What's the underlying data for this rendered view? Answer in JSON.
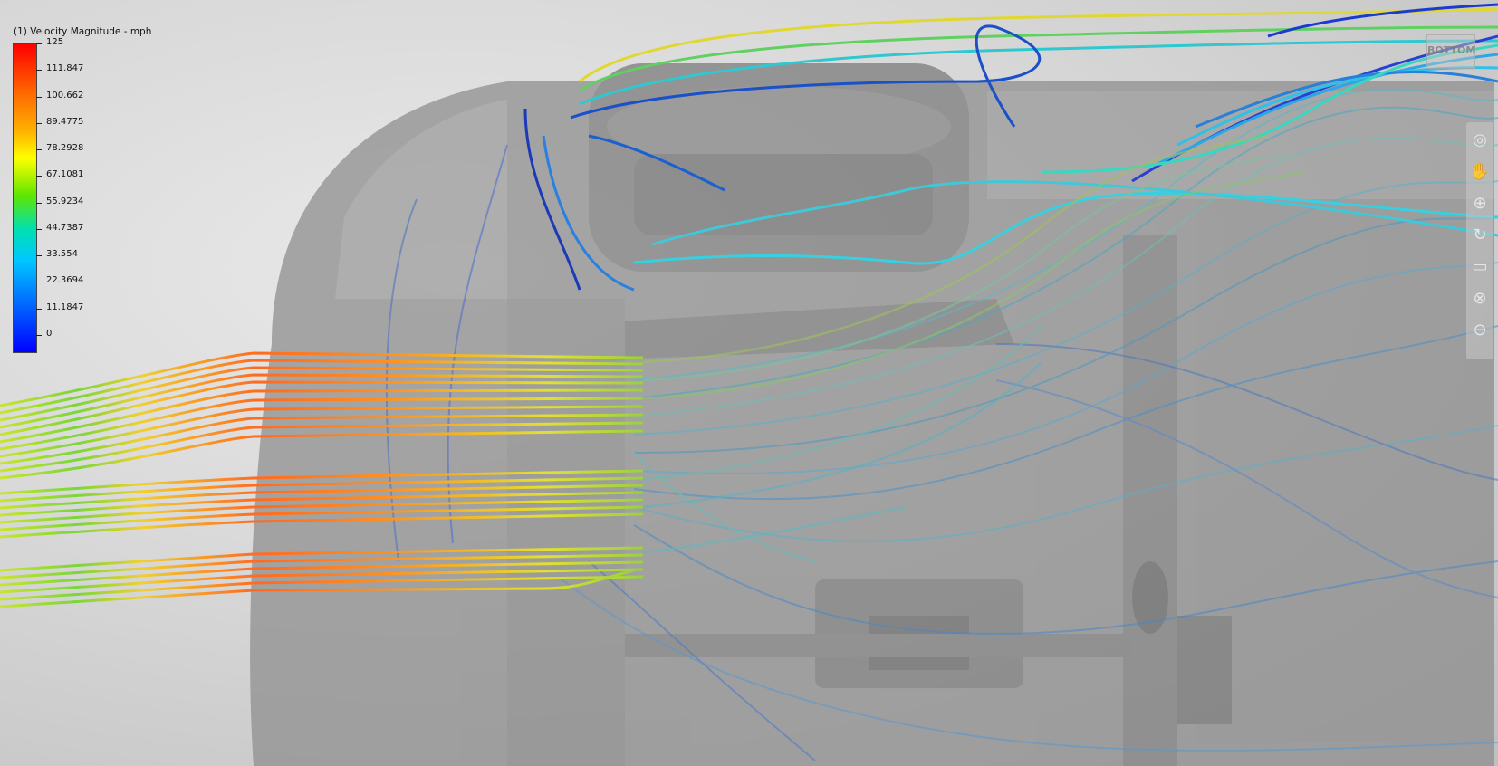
{
  "legend": {
    "title": "(1) Velocity Magnitude - mph",
    "max": 125,
    "min": 0,
    "labels": [
      "125",
      "111.847",
      "100.662",
      "89.4775",
      "78.2928",
      "67.1081",
      "55.9234",
      "44.7387",
      "33.554",
      "22.3694",
      "11.1847",
      "0"
    ]
  },
  "viewcube": {
    "label": "BOTTOM"
  },
  "nav_tools": [
    {
      "name": "steering-wheel-icon",
      "glyph": "◎"
    },
    {
      "name": "pan-hand-icon",
      "glyph": "✋"
    },
    {
      "name": "zoom-icon",
      "glyph": "⊕"
    },
    {
      "name": "orbit-icon",
      "glyph": "↻"
    },
    {
      "name": "lock-icon",
      "glyph": "▭"
    },
    {
      "name": "close-icon",
      "glyph": "⊗"
    },
    {
      "name": "look-icon",
      "glyph": "⊖"
    }
  ],
  "colors": {
    "high": "#ff2a00",
    "mid_high": "#ffa600",
    "mid": "#e8f000",
    "mid_low": "#55dd22",
    "low": "#27c7e8",
    "lowest": "#1a3fd6",
    "body": "#8a8a8a"
  }
}
